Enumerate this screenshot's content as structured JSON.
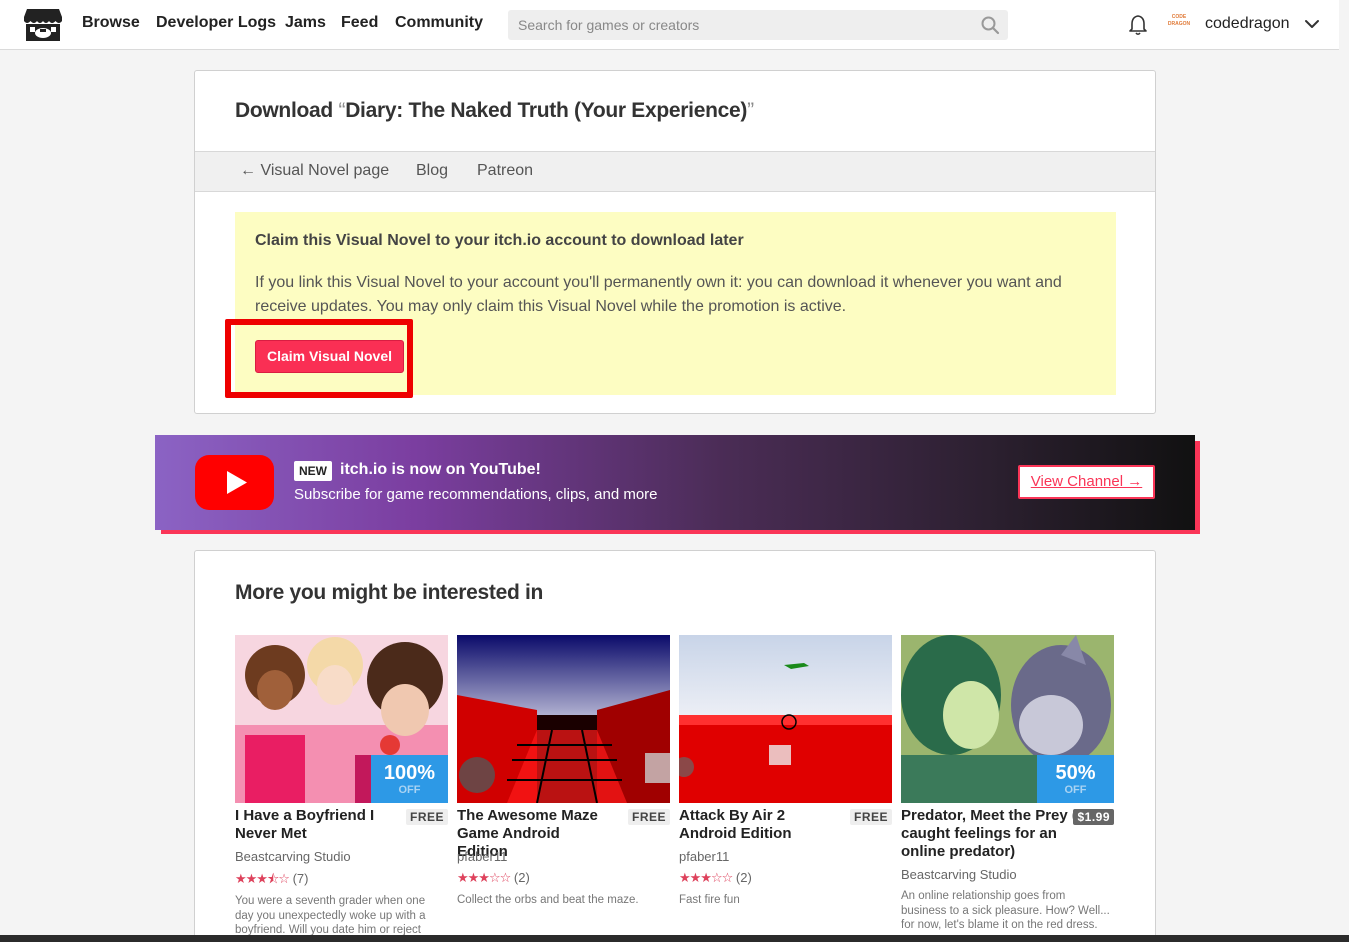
{
  "header": {
    "nav": [
      "Browse",
      "Developer Logs",
      "Jams",
      "Feed",
      "Community"
    ],
    "search_placeholder": "Search for games or creators",
    "avatar_text": "CODE DRAGON",
    "username": "codedragon"
  },
  "download": {
    "title_prefix": "Download",
    "open_quote": "“",
    "game_title": "Diary: The Naked Truth (Your Experience)",
    "close_quote": "”",
    "subnav": [
      "← Visual Novel page",
      "Blog",
      "Patreon"
    ],
    "claim_heading": "Claim this Visual Novel to your itch.io account to download later",
    "claim_text": "If you link this Visual Novel to your account you'll permanently own it: you can download it whenever you want and receive updates. You may only claim this Visual Novel while the promotion is active.",
    "claim_button": "Claim Visual Novel"
  },
  "youtube_banner": {
    "badge": "NEW",
    "title": "itch.io is now on YouTube!",
    "subtitle": "Subscribe for game recommendations, clips, and more",
    "button": "View Channel →"
  },
  "recommendations": {
    "title": "More you might be interested in",
    "items": [
      {
        "title": "I Have a Boyfriend I Never Met",
        "price": "FREE",
        "sale_pct": "100%",
        "sale_off": "OFF",
        "author": "Beastcarving Studio",
        "stars": "★★★⯪☆",
        "rating_count": "(7)",
        "description": "You were a seventh grader when one day you unexpectedly woke up with a boyfriend. Will you date him or reject"
      },
      {
        "title": "The Awesome Maze Game Android Edition",
        "price": "FREE",
        "author": "pfaber11",
        "stars": "★★★☆☆",
        "rating_count": "(2)",
        "description": "Collect the orbs and beat the maze."
      },
      {
        "title": "Attack By Air 2 Android Edition",
        "price": "FREE",
        "author": "pfaber11",
        "stars": "★★★☆☆",
        "rating_count": "(2)",
        "description": "Fast fire fun"
      },
      {
        "title": "Predator, Meet the Prey (I caught feelings for an online predator)",
        "price": "$1.99",
        "sale_pct": "50%",
        "sale_off": "OFF",
        "author": "Beastcarving Studio",
        "description": "An online relationship goes from business to a sick pleasure. How? Well... for now, let's blame it on the red dress."
      }
    ]
  }
}
